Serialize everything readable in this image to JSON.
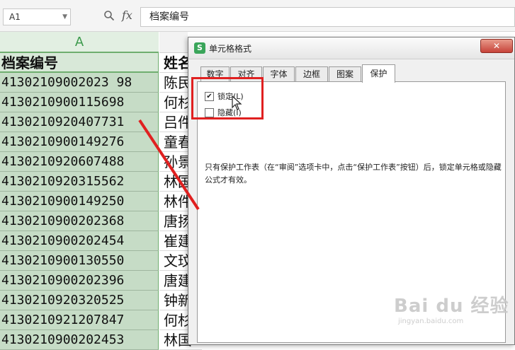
{
  "formula_bar": {
    "name_box": "A1",
    "fx_symbol": "fx",
    "zoom_icon": "magnifier-icon",
    "content": "档案编号"
  },
  "sheet": {
    "column_a_header": "A",
    "header_row": {
      "col_a": "档案编号",
      "col_b": "姓名"
    },
    "rows": [
      {
        "id": "41302109002023 98",
        "name": "陈民"
      },
      {
        "id": "4130210900115698",
        "name": "何杉"
      },
      {
        "id": "4130210920407731",
        "name": "吕件"
      },
      {
        "id": "4130210900149276",
        "name": "童春"
      },
      {
        "id": "4130210920607488",
        "name": "孙景"
      },
      {
        "id": "4130210920315562",
        "name": "林国"
      },
      {
        "id": "4130210900149250",
        "name": "林件"
      },
      {
        "id": "4130210900202368",
        "name": "唐扬"
      },
      {
        "id": "4130210900202454",
        "name": "崔建"
      },
      {
        "id": "4130210900130550",
        "name": "文玟"
      },
      {
        "id": "4130210900202396",
        "name": "唐建"
      },
      {
        "id": "4130210920320525",
        "name": "钟新"
      },
      {
        "id": "4130210921207847",
        "name": "何杉"
      },
      {
        "id": "4130210900202453",
        "name": "林国"
      }
    ],
    "selection_color": "#c6dcc6"
  },
  "dialog": {
    "title": "单元格格式",
    "close_label": "✕",
    "tabs": [
      "数字",
      "对齐",
      "字体",
      "边框",
      "图案",
      "保护"
    ],
    "active_tab": "保护",
    "locked": {
      "label": "锁定(L)",
      "checked": true,
      "mark": "✔"
    },
    "hidden": {
      "label": "隐藏(I)",
      "checked": false
    },
    "description": "只有保护工作表（在“审阅”选项卡中，点击“保护工作表”按钮）后，锁定单元格或隐藏公式才有效。"
  },
  "annotation": {
    "color": "#e02020"
  },
  "watermark": {
    "main": "Bai du 经验",
    "sub": "jingyan.baidu.com"
  }
}
